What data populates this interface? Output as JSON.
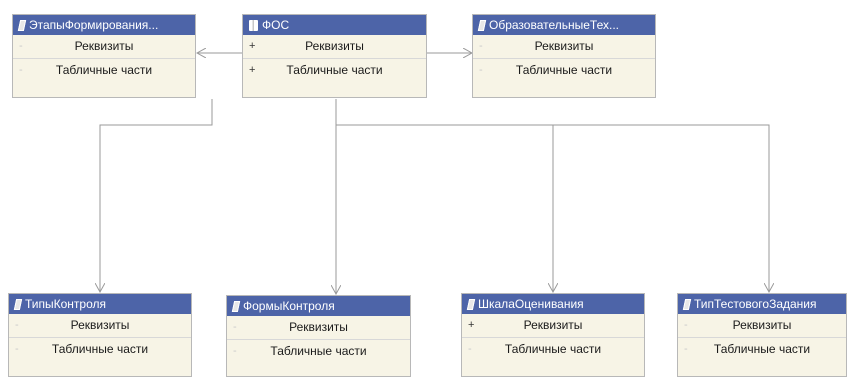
{
  "nodes": {
    "etapy": {
      "title": "ЭтапыФормирования...",
      "icon": "catalog-icon",
      "rows": [
        {
          "mark": "-",
          "label": "Реквизиты"
        },
        {
          "mark": "-",
          "label": "Табличные части"
        }
      ]
    },
    "fos": {
      "title": "ФОС",
      "icon": "object-icon",
      "rows": [
        {
          "mark": "+",
          "label": "Реквизиты"
        },
        {
          "mark": "+",
          "label": "Табличные части"
        }
      ]
    },
    "obraz": {
      "title": "ОбразовательныеТех...",
      "icon": "catalog-icon",
      "rows": [
        {
          "mark": "-",
          "label": "Реквизиты"
        },
        {
          "mark": "-",
          "label": "Табличные части"
        }
      ]
    },
    "tipy": {
      "title": "ТипыКонтроля",
      "icon": "catalog-icon",
      "rows": [
        {
          "mark": "-",
          "label": "Реквизиты"
        },
        {
          "mark": "-",
          "label": "Табличные части"
        }
      ]
    },
    "formy": {
      "title": "ФормыКонтроля",
      "icon": "catalog-icon",
      "rows": [
        {
          "mark": "-",
          "label": "Реквизиты"
        },
        {
          "mark": "-",
          "label": "Табличные части"
        }
      ]
    },
    "shkala": {
      "title": "ШкалаОценивания",
      "icon": "catalog-icon",
      "rows": [
        {
          "mark": "+",
          "label": "Реквизиты"
        },
        {
          "mark": "-",
          "label": "Табличные части"
        }
      ]
    },
    "tip_test": {
      "title": "ТипТестовогоЗадания",
      "icon": "catalog-icon",
      "rows": [
        {
          "mark": "-",
          "label": "Реквизиты"
        },
        {
          "mark": "-",
          "label": "Табличные части"
        }
      ]
    }
  },
  "colors": {
    "header": "#4d64a8",
    "body": "#f7f4e6",
    "connector": "#9a9a9a"
  }
}
